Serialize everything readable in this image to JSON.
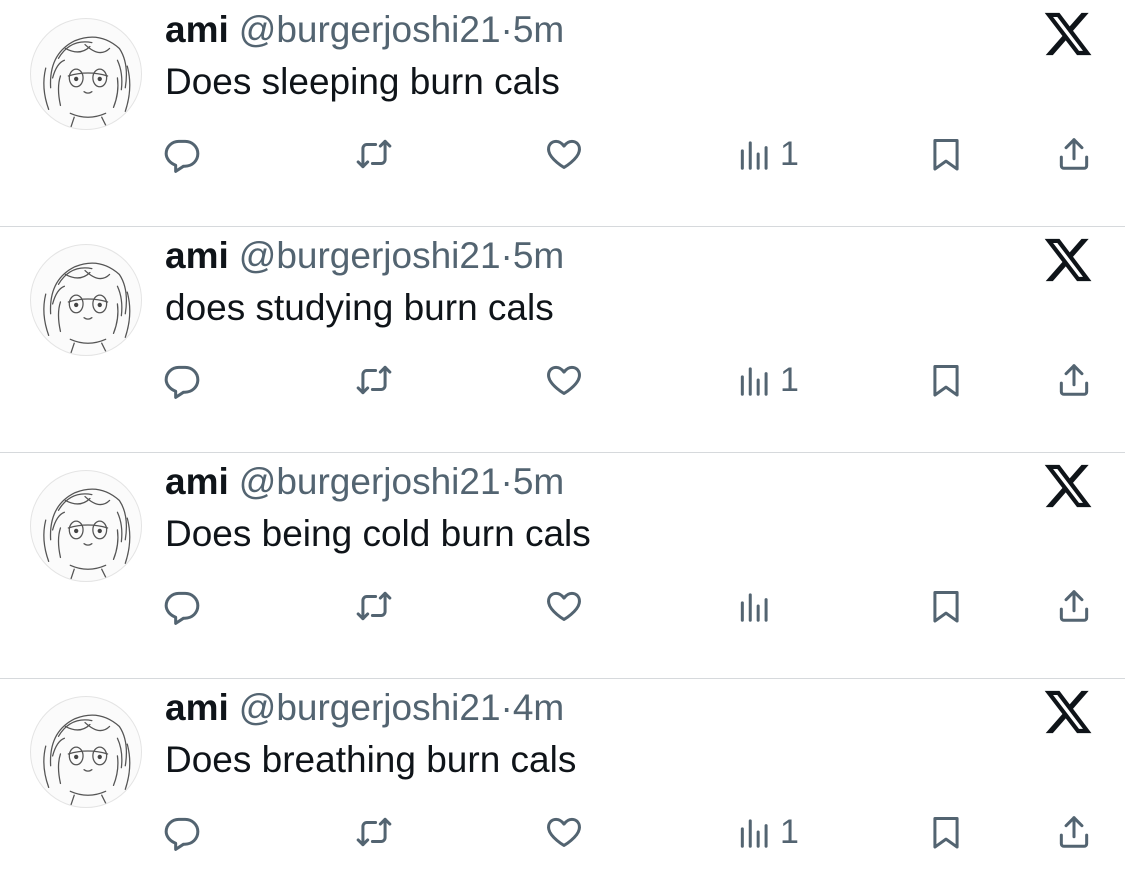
{
  "tweets": [
    {
      "name": "ami",
      "handle": "@burgerjoshi21",
      "separator": "·",
      "time": "5m",
      "text": "Does sleeping burn cals",
      "views": "1"
    },
    {
      "name": "ami",
      "handle": "@burgerjoshi21",
      "separator": "·",
      "time": "5m",
      "text": "does studying burn cals",
      "views": "1"
    },
    {
      "name": "ami",
      "handle": "@burgerjoshi21",
      "separator": "·",
      "time": "5m",
      "text": "Does being cold burn cals",
      "views": ""
    },
    {
      "name": "ami",
      "handle": "@burgerjoshi21",
      "separator": "·",
      "time": "4m",
      "text": "Does breathing burn cals",
      "views": "1"
    }
  ],
  "icons": {
    "reply": "reply-icon",
    "retweet": "retweet-icon",
    "like": "like-icon",
    "views": "views-icon",
    "bookmark": "bookmark-icon",
    "share": "share-icon",
    "platform": "x-logo-icon"
  },
  "colors": {
    "text": "#0f1419",
    "secondary": "#536471",
    "divider": "#d6d9dc",
    "background": "#ffffff"
  }
}
